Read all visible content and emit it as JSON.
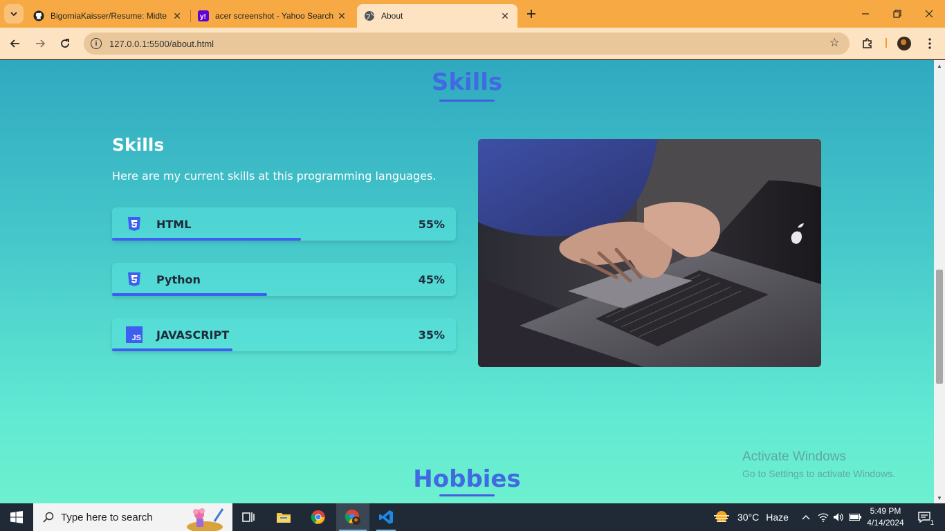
{
  "browser": {
    "tabs": [
      {
        "title": "BigorniaKaisser/Resume: Midte",
        "icon": "github-icon"
      },
      {
        "title": "acer screenshot - Yahoo Search",
        "icon": "yahoo-icon"
      },
      {
        "title": "About",
        "icon": "globe-icon"
      }
    ],
    "url": "127.0.0.1:5500/about.html"
  },
  "page": {
    "section_title": "Skills",
    "skills_heading": "Skills",
    "skills_description": "Here are my current skills at this programming languages.",
    "skills": [
      {
        "name": "HTML",
        "percent_label": "55%",
        "percent": 55,
        "icon": "css3-icon"
      },
      {
        "name": "Python",
        "percent_label": "45%",
        "percent": 45,
        "icon": "css3-icon"
      },
      {
        "name": "JAVASCRIPT",
        "percent_label": "35%",
        "percent": 35,
        "icon": "js-icon"
      }
    ],
    "js_badge": "JS",
    "next_section_title": "Hobbies",
    "watermark_title": "Activate Windows",
    "watermark_subtitle": "Go to Settings to activate Windows."
  },
  "taskbar": {
    "search_placeholder": "Type here to search",
    "weather_temp": "30°C",
    "weather_desc": "Haze",
    "time": "5:49 PM",
    "date": "4/14/2024",
    "notification_count": "1"
  },
  "colors": {
    "accent": "#4169e1",
    "tabbar": "#f7aa44",
    "toolbar": "#fde3c2"
  }
}
